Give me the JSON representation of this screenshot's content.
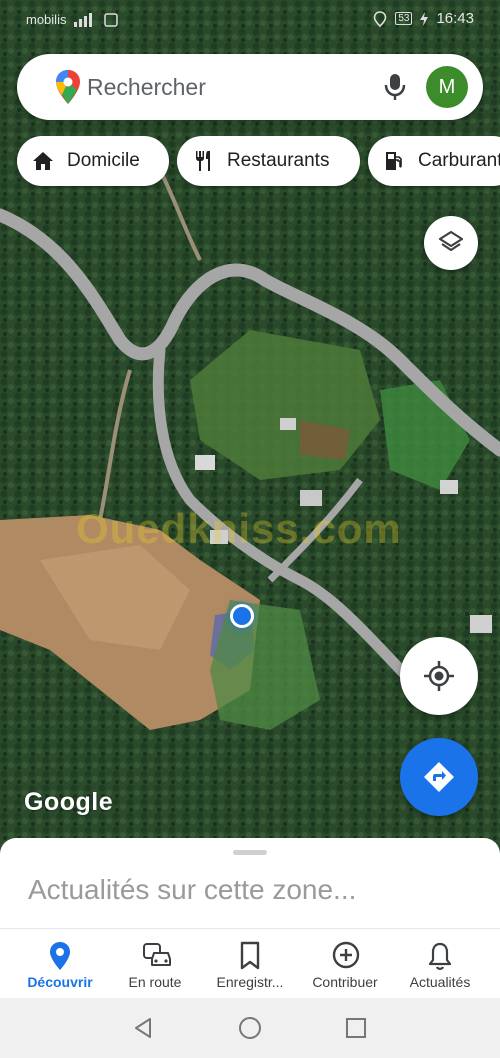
{
  "status_bar": {
    "carrier": "mobilis",
    "battery": "53",
    "time": "16:43"
  },
  "search": {
    "placeholder": "Rechercher",
    "avatar_letter": "M",
    "avatar_color": "#3d8c2c"
  },
  "chips": [
    {
      "label": "Domicile",
      "icon": "home-icon"
    },
    {
      "label": "Restaurants",
      "icon": "restaurant-icon"
    },
    {
      "label": "Carburant",
      "icon": "gas-station-icon"
    }
  ],
  "map": {
    "watermark": "Ouedkniss.com",
    "attribution": "Google",
    "accent_color": "#1a73e8"
  },
  "sheet": {
    "title": "Actualités sur cette zone..."
  },
  "nav": [
    {
      "label": "Découvrir",
      "icon": "explore-pin-icon",
      "active": true
    },
    {
      "label": "En route",
      "icon": "commute-icon",
      "active": false
    },
    {
      "label": "Enregistr...",
      "icon": "bookmark-icon",
      "active": false
    },
    {
      "label": "Contribuer",
      "icon": "add-circle-icon",
      "active": false
    },
    {
      "label": "Actualités",
      "icon": "bell-icon",
      "active": false
    }
  ]
}
